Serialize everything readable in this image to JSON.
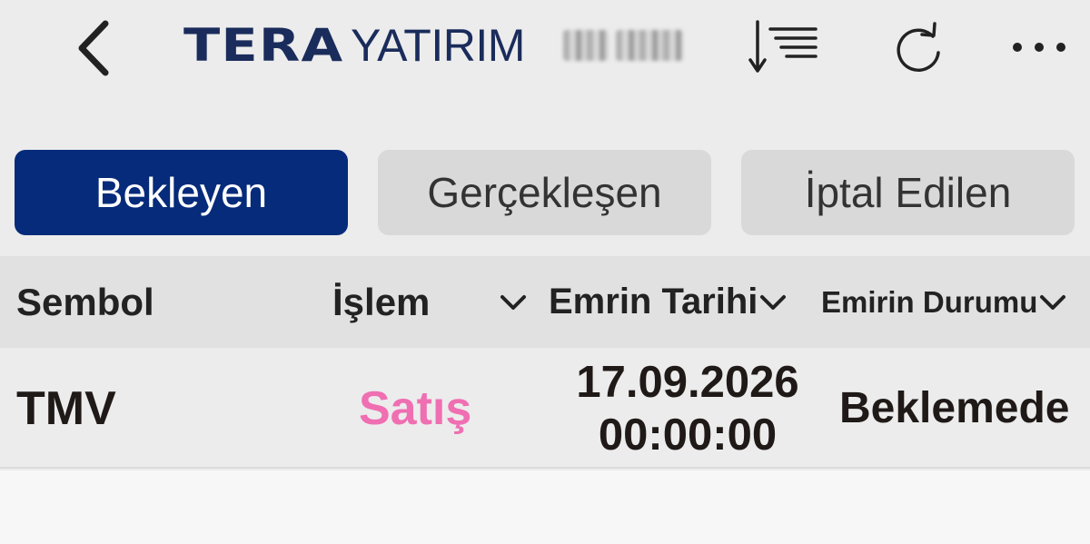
{
  "header": {
    "brand_primary": "TERA",
    "brand_secondary": "YATIRIM",
    "brand_color": "#1a2c5b",
    "icons": {
      "back": "chevron-left-icon",
      "sort": "sort-descending-icon",
      "refresh": "refresh-icon",
      "more": "more-horizontal-icon"
    }
  },
  "tabs": [
    {
      "label": "Bekleyen",
      "active": true
    },
    {
      "label": "Gerçekleşen",
      "active": false
    },
    {
      "label": "İptal Edilen",
      "active": false
    }
  ],
  "table": {
    "columns": [
      "Sembol",
      "İşlem",
      "Emrin Tarihi",
      "Emirin Durumu"
    ],
    "rows": [
      {
        "symbol": "TMV",
        "process": "Satış",
        "date": "17.09.2026",
        "time": "00:00:00",
        "status": "Beklemede"
      }
    ]
  },
  "colors": {
    "active_tab": "#052b7a",
    "inactive_tab": "#d9d9d9",
    "sell": "#ef6fb2",
    "background": "#ececec"
  }
}
